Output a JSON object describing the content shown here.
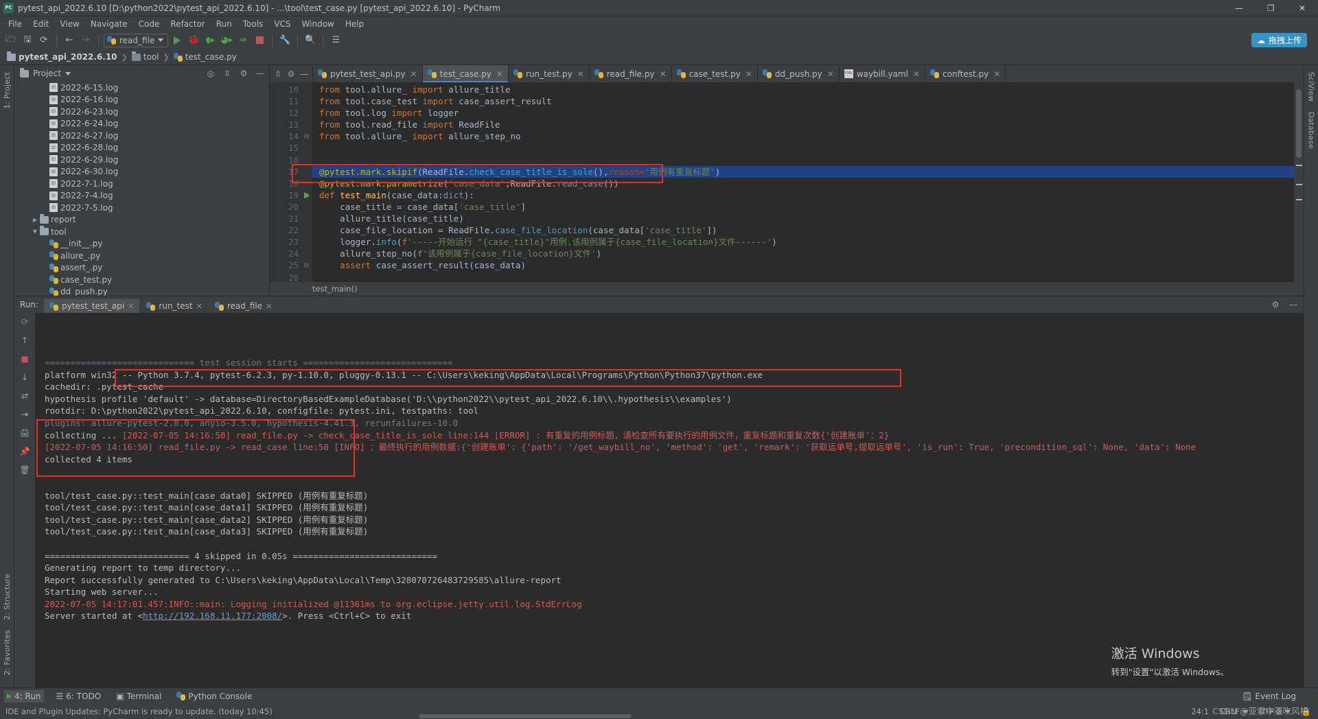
{
  "window": {
    "title": "pytest_api_2022.6.10 [D:\\python2022\\pytest_api_2022.6.10] - ...\\tool\\test_case.py [pytest_api_2022.6.10] - PyCharm",
    "icon_label": "PC",
    "minimize": "—",
    "maximize": "❐",
    "close": "✕"
  },
  "menu": [
    "File",
    "Edit",
    "View",
    "Navigate",
    "Code",
    "Refactor",
    "Run",
    "Tools",
    "VCS",
    "Window",
    "Help"
  ],
  "toolbar": {
    "run_config": "read_file",
    "upload_label": "拖拽上传",
    "icons": [
      "open-folder-icon",
      "save-icon",
      "sync-icon",
      "back-arrow-icon",
      "forward-arrow-icon",
      "run-icon",
      "debug-icon",
      "run-coverage-icon",
      "profile-icon",
      "run-with-console-icon",
      "stop-icon",
      "settings-wrench-icon",
      "search-icon",
      "structure-icon"
    ]
  },
  "breadcrumb": [
    "pytest_api_2022.6.10",
    "tool",
    "test_case.py"
  ],
  "left_strip": [
    "1: Project",
    "2: Structure",
    "2: Favorites"
  ],
  "right_strip": [
    "SciView",
    "Database"
  ],
  "project": {
    "title": "Project",
    "tree": [
      {
        "indent": 2,
        "label": "2022-6-15.log",
        "icon": "log-file-icon",
        "twist": ""
      },
      {
        "indent": 2,
        "label": "2022-6-16.log",
        "icon": "log-file-icon",
        "twist": ""
      },
      {
        "indent": 2,
        "label": "2022-6-23.log",
        "icon": "log-file-icon",
        "twist": ""
      },
      {
        "indent": 2,
        "label": "2022-6-24.log",
        "icon": "log-file-icon",
        "twist": ""
      },
      {
        "indent": 2,
        "label": "2022-6-27.log",
        "icon": "log-file-icon",
        "twist": ""
      },
      {
        "indent": 2,
        "label": "2022-6-28.log",
        "icon": "log-file-icon",
        "twist": ""
      },
      {
        "indent": 2,
        "label": "2022-6-29.log",
        "icon": "log-file-icon",
        "twist": ""
      },
      {
        "indent": 2,
        "label": "2022-6-30.log",
        "icon": "log-file-icon",
        "twist": ""
      },
      {
        "indent": 2,
        "label": "2022-7-1.log",
        "icon": "log-file-icon",
        "twist": ""
      },
      {
        "indent": 2,
        "label": "2022-7-4.log",
        "icon": "log-file-icon",
        "twist": ""
      },
      {
        "indent": 2,
        "label": "2022-7-5.log",
        "icon": "log-file-icon",
        "twist": ""
      },
      {
        "indent": 1,
        "label": "report",
        "icon": "folder-icon",
        "twist": "▶"
      },
      {
        "indent": 1,
        "label": "tool",
        "icon": "folder-icon",
        "twist": "▼"
      },
      {
        "indent": 2,
        "label": "__init__.py",
        "icon": "python-file-icon",
        "twist": ""
      },
      {
        "indent": 2,
        "label": "allure_.py",
        "icon": "python-file-icon",
        "twist": ""
      },
      {
        "indent": 2,
        "label": "assert_.py",
        "icon": "python-file-icon",
        "twist": ""
      },
      {
        "indent": 2,
        "label": "case_test.py",
        "icon": "python-file-icon",
        "twist": ""
      },
      {
        "indent": 2,
        "label": "dd_push.py",
        "icon": "python-file-icon",
        "twist": ""
      }
    ]
  },
  "editor": {
    "tabs": [
      {
        "label": "pytest_test_api.py",
        "icon": "python-file-icon",
        "active": false
      },
      {
        "label": "test_case.py",
        "icon": "python-file-icon",
        "active": true
      },
      {
        "label": "run_test.py",
        "icon": "python-file-icon",
        "active": false
      },
      {
        "label": "read_file.py",
        "icon": "python-file-icon",
        "active": false
      },
      {
        "label": "case_test.py",
        "icon": "python-file-icon",
        "active": false
      },
      {
        "label": "dd_push.py",
        "icon": "python-file-icon",
        "active": false
      },
      {
        "label": "waybill.yaml",
        "icon": "yaml-file-icon",
        "active": false
      },
      {
        "label": "conftest.py",
        "icon": "python-file-icon",
        "active": false
      }
    ],
    "first_line_number": 10,
    "lines": [
      {
        "n": 10,
        "html": "<span class='kw'>from</span> <span class='pl'>tool.allure_</span> <span class='kw'>import</span> <span class='pl'>allure_title</span>"
      },
      {
        "n": 11,
        "html": "<span class='kw'>from</span> <span class='pl'>tool.case_test</span> <span class='kw'>import</span> <span class='pl'>case_assert_result</span>"
      },
      {
        "n": 12,
        "html": "<span class='kw'>from</span> <span class='pl'>tool.log</span> <span class='kw'>import</span> <span class='pl'>logger</span>"
      },
      {
        "n": 13,
        "html": "<span class='kw'>from</span> <span class='pl'>tool.read_file</span> <span class='kw'>import</span> <span class='pl'>ReadFile</span>"
      },
      {
        "n": 14,
        "html": "<span class='kw'>from</span> <span class='pl'>tool.allure_</span> <span class='kw'>import</span> <span class='pl'>allure_step_no</span>"
      },
      {
        "n": 15,
        "html": ""
      },
      {
        "n": 16,
        "html": ""
      },
      {
        "n": 17,
        "html": "<span class='dec'>@pytest.mark.skipif</span><span class='pl'>(ReadFile.</span><span class='mth'>check_case_title_is_sole</span><span class='pl'>(),</span><span class='param'>reason=</span><span class='str'>'用例有重复标题'</span><span class='pl'>)</span>"
      },
      {
        "n": 18,
        "html": "<span class='dec'>@pytest.mark.parametrize</span><span class='pl'>(</span><span class='str'>'case_data'</span><span class='pl'>,ReadFile.</span><span class='mth'>read_case</span><span class='pl'>())</span>"
      },
      {
        "n": 19,
        "html": "<span class='kw'>def</span> <span class='fn'>test_main</span><span class='pl'>(case_data:</span><span class='builtin'>dict</span><span class='pl'>):</span>"
      },
      {
        "n": 20,
        "html": "    <span class='pl'>case_title = case_data[</span><span class='str'>'case_title'</span><span class='pl'>]</span>"
      },
      {
        "n": 21,
        "html": "    <span class='pl'>allure_title(case_title)</span>"
      },
      {
        "n": 22,
        "html": "    <span class='pl'>case_file_location = ReadFile.</span><span class='mth'>case_file_location</span><span class='pl'>(case_data[</span><span class='str'>'case_title'</span><span class='pl'>])</span>"
      },
      {
        "n": 23,
        "html": "    <span class='pl'>logger.</span><span class='mth'>info</span><span class='pl'>(</span><span class='kw'>f</span><span class='str'>'-----开始运行 \"{case_title}\"用例,该用例属于{case_file_location}文件------'</span><span class='pl'>)</span>"
      },
      {
        "n": 24,
        "html": "    <span class='pl'>allure_step_no(</span><span class='kw'>f</span><span class='str'>'该用例属于{case_file_location}文件'</span><span class='pl'>)</span>"
      },
      {
        "n": 25,
        "html": "    <span class='kw'>assert</span> <span class='pl'>case_assert_result(case_data)</span>"
      },
      {
        "n": 26,
        "html": ""
      }
    ],
    "bottom_breadcrumb": "test_main()",
    "highlighted_line": 17
  },
  "run": {
    "label": "Run:",
    "tabs": [
      {
        "label": "pytest_test_api",
        "active": true
      },
      {
        "label": "run_test",
        "active": false
      },
      {
        "label": "read_file",
        "active": false
      }
    ],
    "gutter_icons": [
      "rerun-icon",
      "scroll-up-icon",
      "stop-icon",
      "scroll-down-icon",
      "print-icon",
      "export-icon",
      "pin-icon",
      "trash-icon"
    ],
    "console_lines": [
      {
        "text": "============================= test session starts =============================",
        "cls": "c-dim",
        "clipped": true
      },
      {
        "text": "platform win32 -- Python 3.7.4, pytest-6.2.3, py-1.10.0, pluggy-0.13.1 -- C:\\Users\\keking\\AppData\\Local\\Programs\\Python\\Python37\\python.exe",
        "cls": ""
      },
      {
        "text": "cachedir: .pytest_cache",
        "cls": ""
      },
      {
        "text": "hypothesis profile 'default' -> database=DirectoryBasedExampleDatabase('D:\\\\python2022\\\\pytest_api_2022.6.10\\\\.hypothesis\\\\examples')",
        "cls": ""
      },
      {
        "text": "rootdir: D:\\python2022\\pytest_api_2022.6.10, configfile: pytest.ini, testpaths: tool",
        "cls": ""
      },
      {
        "text": "plugins: allure-pytest-2.8.0, anyio-3.5.0, hypothesis-4.41.3, rerunfailures-10.0",
        "cls": "",
        "clipped": true
      },
      {
        "text": "collecting ... ",
        "cls": "",
        "suffix_red": "[2022-07-05 14:16:50] read_file.py -> check_case_title_is_sole line:144 [ERROR] : 有重复的用例标题，请检查所有要执行的用例文件，重复标题和重复次数{'创建账单'：2}"
      },
      {
        "text": "[2022-07-05 14:16:50] read_file.py -> read_case line:50 [INFO] ：最终执行的用例数据:{'创建账单': {'path': '/get_waybill_no', 'method': 'get', 'remark': '获取运单号,提取运单号', 'is_run': True, 'precondition_sql': None, 'data': None",
        "cls": "c-red"
      },
      {
        "text": "collected 4 items",
        "cls": ""
      },
      {
        "text": "",
        "cls": ""
      },
      {
        "text": "",
        "cls": ""
      },
      {
        "text": "tool/test_case.py::test_main[case_data0] SKIPPED (用例有重复标题)",
        "cls": ""
      },
      {
        "text": "tool/test_case.py::test_main[case_data1] SKIPPED (用例有重复标题)",
        "cls": ""
      },
      {
        "text": "tool/test_case.py::test_main[case_data2] SKIPPED (用例有重复标题)",
        "cls": ""
      },
      {
        "text": "tool/test_case.py::test_main[case_data3] SKIPPED (用例有重复标题)",
        "cls": ""
      },
      {
        "text": "",
        "cls": ""
      },
      {
        "text": "============================ 4 skipped in 0.05s ============================",
        "cls": ""
      },
      {
        "text": "Generating report to temp directory...",
        "cls": ""
      },
      {
        "text": "Report successfully generated to C:\\Users\\keking\\AppData\\Local\\Temp\\328070726483729585\\allure-report",
        "cls": ""
      },
      {
        "text": "Starting web server...",
        "cls": ""
      },
      {
        "text": "2022-07-05 14:17:01.457:INFO::main: Logging initialized @11361ms to org.eclipse.jetty.util.log.StdErrLog",
        "cls": "c-red"
      },
      {
        "text": "Server started at <",
        "cls": "",
        "link": "http://192.168.11.177:2008/",
        "after": ">. Press <Ctrl+C> to exit"
      }
    ]
  },
  "toolwindow_bar": {
    "items": [
      {
        "label": "4: Run",
        "icon": "run-icon",
        "active": true
      },
      {
        "label": "6: TODO",
        "icon": "todo-icon",
        "active": false
      },
      {
        "label": "Terminal",
        "icon": "terminal-icon",
        "active": false
      },
      {
        "label": "Python Console",
        "icon": "python-console-icon",
        "active": false
      }
    ],
    "right": {
      "label": "Event Log",
      "icon": "event-log-icon"
    }
  },
  "statusbar": {
    "message": "IDE and Plugin Updates: PyCharm is ready to update. (today 10:45)",
    "caret": "24:1",
    "line_sep": "CRLF",
    "encoding": "UTF-8",
    "indent": "4 spaces",
    "branch": "",
    "lock_icon": "lock-icon"
  },
  "watermark": {
    "line1": "激活 Windows",
    "line2": "转到\"设置\"以激活 Windows。",
    "csdn": "CSDN @亚索中亚吹风机"
  },
  "colors": {
    "accent": "#4a88c7",
    "annotation_red": "#ec2b2b",
    "upload_blue": "#3592c4",
    "editor_bg": "#2b2b2b",
    "chrome_bg": "#3c3f41"
  }
}
